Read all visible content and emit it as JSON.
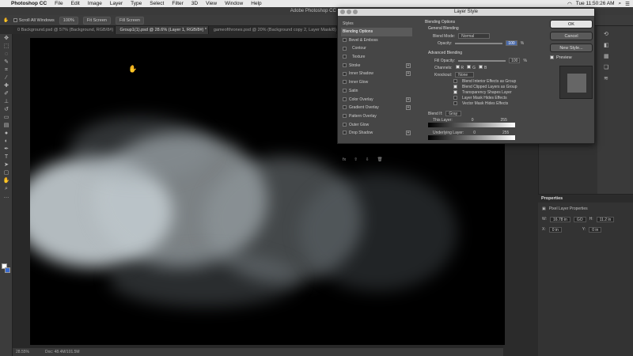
{
  "menubar": {
    "app_name": "Photoshop CC",
    "items": [
      "File",
      "Edit",
      "Image",
      "Layer",
      "Type",
      "Select",
      "Filter",
      "3D",
      "View",
      "Window",
      "Help"
    ],
    "clock": "Tue 11:50:26 AM"
  },
  "titlebar": {
    "title": "Adobe Photoshop CC 20"
  },
  "options": {
    "scroll_all": "Scroll All Windows",
    "zoom": "100%",
    "fit_screen": "Fit Screen",
    "fill_screen": "Fill Screen"
  },
  "tabs": [
    "0 Background.psd @ 57% (Background, RGB/8#)",
    "Group1(1).psd @ 28.6% (Layer 1, RGB/8#) *",
    "gameofthrones.psd @ 20% (Background copy 2, Layer Mask/8)"
  ],
  "status": {
    "zoom": "28.55%",
    "doc": "Doc: 48.4M/101.5M"
  },
  "dialog": {
    "title": "Layer Style",
    "styles_header": "Styles",
    "styles": [
      {
        "label": "Blending Options",
        "selected": true,
        "plus": false
      },
      {
        "label": "Bevel & Emboss",
        "selected": false,
        "plus": false
      },
      {
        "label": "Contour",
        "selected": false,
        "plus": false
      },
      {
        "label": "Texture",
        "selected": false,
        "plus": false
      },
      {
        "label": "Stroke",
        "selected": false,
        "plus": true
      },
      {
        "label": "Inner Shadow",
        "selected": false,
        "plus": true
      },
      {
        "label": "Inner Glow",
        "selected": false,
        "plus": false
      },
      {
        "label": "Satin",
        "selected": false,
        "plus": false
      },
      {
        "label": "Color Overlay",
        "selected": false,
        "plus": true
      },
      {
        "label": "Gradient Overlay",
        "selected": false,
        "plus": true
      },
      {
        "label": "Pattern Overlay",
        "selected": false,
        "plus": false
      },
      {
        "label": "Outer Glow",
        "selected": false,
        "plus": false
      },
      {
        "label": "Drop Shadow",
        "selected": false,
        "plus": true
      }
    ],
    "fx": "fx",
    "blending": {
      "heading": "Blending Options",
      "general": "General Blending",
      "blend_mode_label": "Blend Mode:",
      "blend_mode": "Normal",
      "opacity_label": "Opacity:",
      "opacity": "100",
      "percent": "%",
      "advanced": "Advanced Blending",
      "fill_opacity_label": "Fill Opacity:",
      "fill_opacity": "100",
      "channels_label": "Channels:",
      "ch_r": "R",
      "ch_g": "G",
      "ch_b": "B",
      "knockout_label": "Knockout:",
      "knockout": "None",
      "opt1": "Blend Interior Effects as Group",
      "opt2": "Blend Clipped Layers as Group",
      "opt3": "Transparency Shapes Layer",
      "opt4": "Layer Mask Hides Effects",
      "opt5": "Vector Mask Hides Effects",
      "blend_if_label": "Blend If:",
      "blend_if": "Gray",
      "this_layer": "This Layer:",
      "this_min": "0",
      "this_max": "255",
      "underlying": "Underlying Layer:",
      "under_min": "0",
      "under_max": "255"
    },
    "buttons": {
      "ok": "OK",
      "cancel": "Cancel",
      "new_style": "New Style...",
      "preview": "Preview"
    }
  },
  "properties": {
    "title": "Properties",
    "kind": "Pixel Layer Properties",
    "w_label": "W:",
    "w": "16.78 in",
    "go_label": "GO",
    "h_label": "H:",
    "h": "11.2 in",
    "x_label": "X:",
    "x": "0 in",
    "y_label": "Y:",
    "y": "0 in"
  }
}
